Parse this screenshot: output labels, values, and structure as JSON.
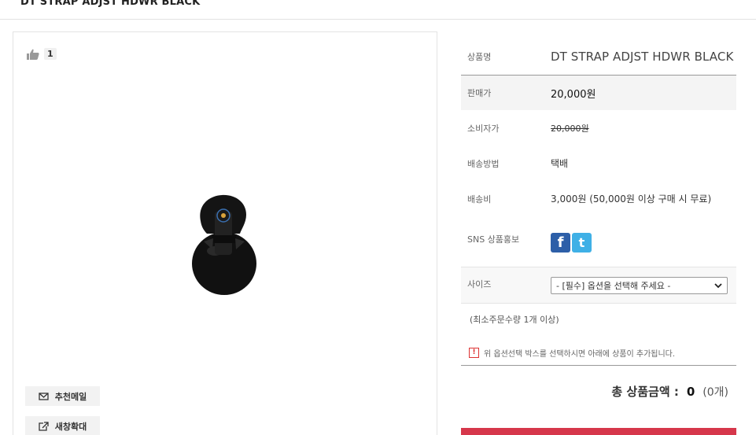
{
  "header": {
    "title": "DT STRAP ADJST HDWR BLACK"
  },
  "gallery": {
    "like_count": "1",
    "email_button": "추천메일",
    "zoom_button": "새창확대"
  },
  "product": {
    "name_label": "상품명",
    "name": "DT STRAP ADJST HDWR BLACK",
    "price_label": "판매가",
    "price": "20,000원",
    "consumer_label": "소비자가",
    "consumer_price": "20,000원",
    "shipping_method_label": "배송방법",
    "shipping_method": "택배",
    "shipping_fee_label": "배송비",
    "shipping_fee": "3,000원 (50,000원 이상 구매 시 무료)",
    "sns_label": "SNS 상품홍보",
    "sns_icons": [
      "facebook-icon",
      "twitter-icon"
    ]
  },
  "options": {
    "size_label": "사이즈",
    "size_select_value": "- [필수] 옵션을 선택해 주세요 -",
    "min_order": "(최소주문수량 1개 이상)",
    "notice_mark": "!",
    "notice": "위 옵션선택 박스를 선택하시면 아래에 상품이 추가됩니다."
  },
  "total": {
    "label": "총 상품금액 :",
    "amount": "0",
    "quantity": "(0개)"
  },
  "colors": {
    "buy_button": "#d6374b",
    "facebook": "#2d5fa8",
    "twitter": "#3fb0e6"
  }
}
